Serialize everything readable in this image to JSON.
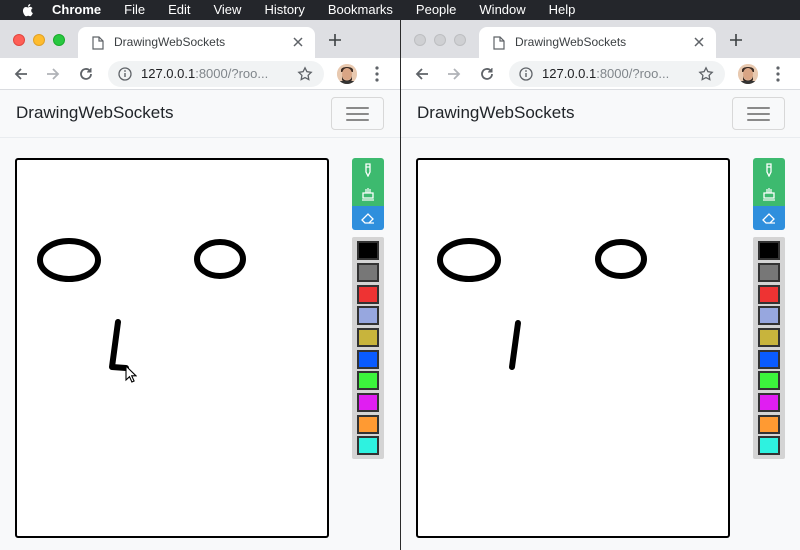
{
  "menubar": {
    "items": [
      "Chrome",
      "File",
      "Edit",
      "View",
      "History",
      "Bookmarks",
      "People",
      "Window",
      "Help"
    ]
  },
  "windows": [
    {
      "tab_title": "DrawingWebSockets",
      "url_host": "127.0.0.1",
      "url_rest": ":8000/?roo...",
      "brand": "DrawingWebSockets",
      "active_tool": "pen"
    },
    {
      "tab_title": "DrawingWebSockets",
      "url_host": "127.0.0.1",
      "url_rest": ":8000/?roo...",
      "brand": "DrawingWebSockets",
      "active_tool": "pen"
    }
  ],
  "tools": [
    {
      "name": "pen-icon",
      "color": "#3dba6f"
    },
    {
      "name": "bucket-icon",
      "color": "#3dba6f"
    },
    {
      "name": "eraser-icon",
      "color": "#2f8fdd"
    }
  ],
  "tool_colors": {
    "active": "#3dba6f",
    "inactive": "#2f8fdd"
  },
  "palette": [
    "#000000",
    "#777777",
    "#ee3333",
    "#97a7df",
    "#c8b43c",
    "#0a5bff",
    "#3cf43c",
    "#e01ef2",
    "#ff9a32",
    "#2ef2e0"
  ]
}
